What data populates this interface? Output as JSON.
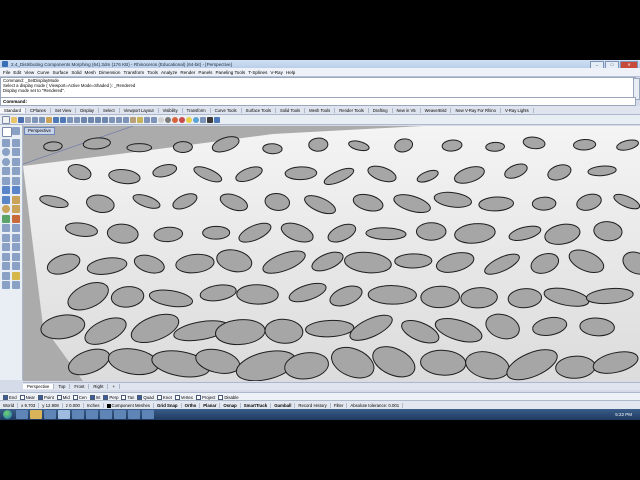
{
  "window": {
    "title": "2.4_Distributing Components Morphing (64).3dm (176 KB) - Rhinoceros (Educational) (64-bit) - [Perspective]"
  },
  "menu": [
    "File",
    "Edit",
    "View",
    "Curve",
    "Surface",
    "Solid",
    "Mesh",
    "Dimension",
    "Transform",
    "Tools",
    "Analyze",
    "Render",
    "Panels",
    "Paneling Tools",
    "T-Splines",
    "V-Ray",
    "Help"
  ],
  "history": [
    "Command: _SetDisplayMode",
    "Select a display mode ( Viewport=Active  Mode=Shaded ): _Rendered",
    "Display mode set to \"Rendered\"."
  ],
  "command": {
    "label": "Command:"
  },
  "toolbar_tabs": [
    "Standard",
    "CPlanes",
    "Set View",
    "Display",
    "Select",
    "Viewport Layout",
    "Visibility",
    "Transform",
    "Curve Tools",
    "Surface Tools",
    "Solid Tools",
    "Mesh Tools",
    "Render Tools",
    "Drafting",
    "New in V5",
    "WeaverBird",
    "New V-Ray For Rhino",
    "V-Ray Lights"
  ],
  "viewport": {
    "label": "Perspective"
  },
  "viewport_tabs": [
    "Perspective",
    "Top",
    "Front",
    "Right"
  ],
  "osnaps": [
    {
      "label": "End",
      "on": true
    },
    {
      "label": "Near",
      "on": false
    },
    {
      "label": "Point",
      "on": true
    },
    {
      "label": "Mid",
      "on": false
    },
    {
      "label": "Cen",
      "on": false
    },
    {
      "label": "Int",
      "on": true
    },
    {
      "label": "Perp",
      "on": true
    },
    {
      "label": "Tan",
      "on": false
    },
    {
      "label": "Quad",
      "on": true
    },
    {
      "label": "Knot",
      "on": false
    },
    {
      "label": "Vertex",
      "on": false
    },
    {
      "label": "Project",
      "on": false
    },
    {
      "label": "Disable",
      "on": false
    }
  ],
  "status": {
    "cplane": "World",
    "x": "x 9.703",
    "y": "y 12.908",
    "z": "z 0.000",
    "units": "Inches",
    "layer": "Component Meshes",
    "toggles": [
      "Grid Snap",
      "Ortho",
      "Planar",
      "Osnap",
      "SmartTrack",
      "Gumball"
    ],
    "record": "Record History",
    "filter": "Filter",
    "tolerance": "Absolute tolerance: 0.001"
  },
  "taskbar": {
    "time": "5:22 PM"
  },
  "colors": {
    "viewport_bg": "#ababab",
    "ui_bg": "#d6dbe9",
    "taskbar": "#1e3a60"
  }
}
